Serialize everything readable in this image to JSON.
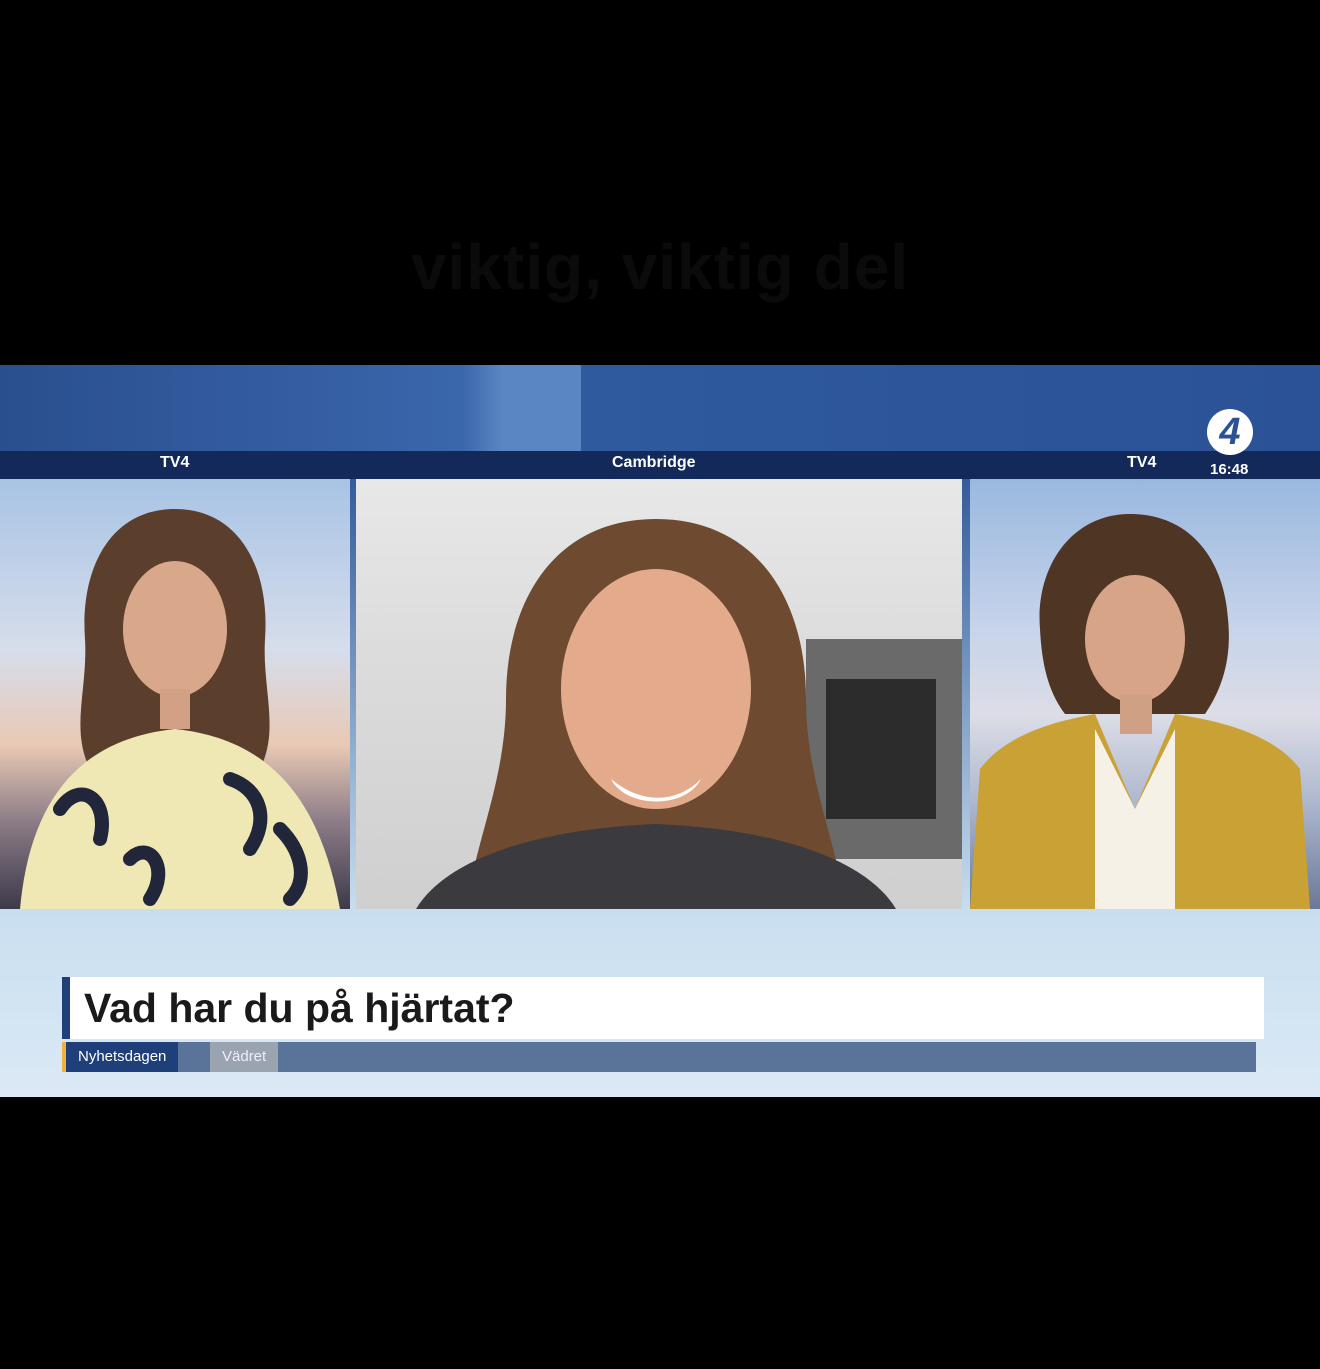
{
  "overlay_caption": "viktig, viktig del",
  "broadcast": {
    "pane_labels": {
      "left": "TV4",
      "center": "Cambridge",
      "right": "TV4"
    },
    "logo_text": "4",
    "clock": "16:48",
    "headline": "Vad har du på hjärtat?",
    "ticker_tabs": [
      {
        "label": "Nyhetsdagen",
        "active": true
      },
      {
        "label": "Vädret",
        "active": false
      }
    ]
  },
  "colors": {
    "header_blue": "#2b5294",
    "label_bar": "#13295a",
    "accent_yellow": "#f2b33d"
  }
}
